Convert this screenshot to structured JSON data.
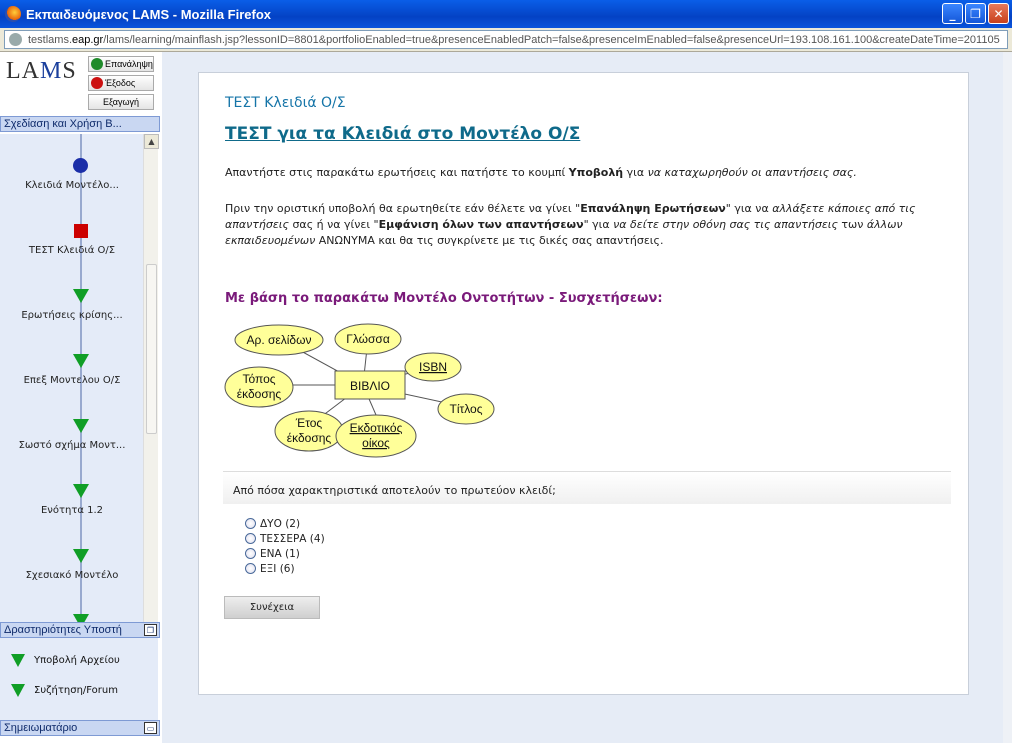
{
  "window": {
    "title": "Εκπαιδευόμενος LAMS - Mozilla Firefox",
    "url_host": "testlams.",
    "url_domain": "eap.gr",
    "url_rest": "/lams/learning/mainflash.jsp?lessonID=8801&portfolioEnabled=true&presenceEnabledPatch=false&presenceImEnabled=false&presenceUrl=193.108.161.100&createDateTime=201105"
  },
  "sidebar": {
    "logo_a": "LA",
    "logo_m": "M",
    "logo_b": "S",
    "buttons": {
      "repeat": "Επανάληψη",
      "exit": "Έξοδος",
      "export": "Εξαγωγή"
    },
    "lesson_header": "Σχεδίαση και Χρήση Β...",
    "sequence": [
      {
        "label": "Κλειδιά Μοντέλο...",
        "shape": "circle"
      },
      {
        "label": "ΤΕΣΤ Κλειδιά Ο/Σ",
        "shape": "square"
      },
      {
        "label": "Ερωτήσεις κρίσης...",
        "shape": "triangle"
      },
      {
        "label": "Επεξ Μοντελου Ο/Σ",
        "shape": "triangle"
      },
      {
        "label": "Σωστό σχήμα Μοντ...",
        "shape": "triangle"
      },
      {
        "label": "Ενότητα 1.2",
        "shape": "triangle"
      },
      {
        "label": "Σχεσιακό Μοντέλο",
        "shape": "triangle"
      }
    ],
    "support_header": "Δραστηριότητες Υποστή",
    "support_items": [
      "Υποβολή Αρχείου",
      "Συζήτηση/Forum"
    ],
    "notebook_header": "Σημειωματάριο"
  },
  "content": {
    "title": "ΤΕΣΤ Κλειδιά Ο/Σ",
    "heading": "ΤΕΣΤ για τα Κλειδιά στο Μοντέλο Ο/Σ",
    "p1_a": "Απαντήστε στις παρακάτω ερωτήσεις και πατήστε το κουμπί ",
    "p1_b": "Υποβολή",
    "p1_c": " για ",
    "p1_d": "να καταχωρηθούν οι απαντήσεις σας.",
    "p2_a": "Πριν την οριστική υποβολή θα ερωτηθείτε εάν θέλετε να γίνει \"",
    "p2_b": "Επανάληψη Ερωτήσεων",
    "p2_c": "\" για να ",
    "p2_d": "αλλάξετε κάποιες από τις απαντήσεις",
    "p2_e": " σας ή να γίνει \"",
    "p2_f": "Εμφάνιση όλων των απαντήσεων",
    "p2_g": "\" για ",
    "p2_h": "να δείτε στην οθόνη σας τις απαντήσεις",
    "p2_i": " των ",
    "p2_j": "άλλων εκπαιδευομένων",
    "p2_k": " ΑΝΩΝΥΜΑ και θα τις συγκρίνετε με τις δικές σας απαντήσεις.",
    "subheading": "Με βάση το παρακάτω Μοντέλο Οντοτήτων - Συσχετήσεων:",
    "diagram": {
      "entity": "ΒΙΒΛΙΟ",
      "attrs": {
        "pages": "Αρ. σελίδων",
        "lang": "Γλώσσα",
        "isbn": "ISBN",
        "place1": "Τόπος",
        "place2": "έκδοσης",
        "title": "Τίτλος",
        "year1": "Έτος",
        "year2": "έκδοσης",
        "pub1": "Εκδοτικός",
        "pub2": "οίκος"
      }
    },
    "question": "Από πόσα χαρακτηριστικά αποτελούν το πρωτεύον κλειδί;",
    "options": [
      "ΔΥΟ (2)",
      "ΤΕΣΣΕΡΑ (4)",
      "ΕΝΑ (1)",
      "ΕΞΙ (6)"
    ],
    "next_button": "Συνέχεια"
  }
}
